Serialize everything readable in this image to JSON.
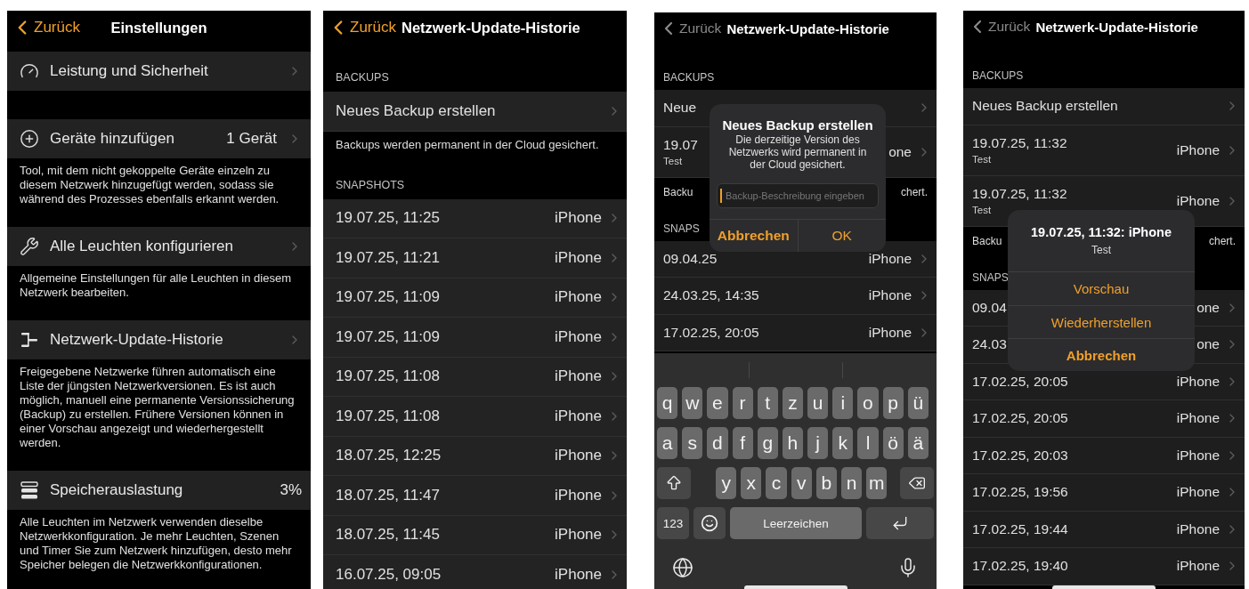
{
  "screens": [
    {
      "kind": "settings",
      "back": "Zurück",
      "title": "Einstellungen",
      "dimmed": false,
      "home_indicator": false,
      "groups": [
        {
          "label": "Leistung und Sicherheit",
          "disclosure": true
        },
        {
          "label": "Geräte hinzufügen",
          "value": "1 Gerät",
          "disclosure": true,
          "footer": "Tool, mit dem nicht gekoppelte Geräte einzeln zu diesem Netzwerk hinzugefügt werden, sodass sie während des Prozesses ebenfalls erkannt werden."
        },
        {
          "label": "Alle Leuchten konfigurieren",
          "disclosure": true,
          "footer": "Allgemeine Einstellungen für alle Leuchten in diesem Netzwerk bearbeiten."
        },
        {
          "label": "Netzwerk-Update-Historie",
          "disclosure": true,
          "footer": "Freigegebene Netzwerke führen automatisch eine Liste der jüngsten Netzwerkversionen. Es ist auch möglich, manuell eine permanente Versionssicherung (Backup) zu erstellen. Frühere Versionen können in einer Vorschau angezeigt und wiederhergestellt werden."
        },
        {
          "label": "Speicherauslastung",
          "value": "3%",
          "disclosure": false,
          "footer": "Alle Leuchten im Netzwerk verwenden dieselbe Netzwerkkonfiguration. Je mehr Leuchten, Szenen und Timer Sie zum Netzwerk hinzufügen, desto mehr Speicher belegen die Netzwerkkonfigurationen."
        }
      ]
    },
    {
      "kind": "history",
      "back": "Zurück",
      "title": "Netzwerk-Update-Historie",
      "dimmed": false,
      "home_indicator": false,
      "sections": [
        {
          "header": "BACKUPS",
          "rows": [
            {
              "label": "Neues Backup erstellen"
            }
          ],
          "footer": [
            "Backups werden permanent in der Cloud gesichert."
          ]
        },
        {
          "header": "SNAPSHOTS",
          "rows": [
            {
              "label": "19.07.25, 11:25",
              "device": "iPhone"
            },
            {
              "label": "19.07.25, 11:21",
              "device": "iPhone"
            },
            {
              "label": "19.07.25, 11:09",
              "device": "iPhone"
            },
            {
              "label": "19.07.25, 11:09",
              "device": "iPhone"
            },
            {
              "label": "19.07.25, 11:08",
              "device": "iPhone"
            },
            {
              "label": "19.07.25, 11:08",
              "device": "iPhone"
            },
            {
              "label": "18.07.25, 12:25",
              "device": "iPhone"
            },
            {
              "label": "18.07.25, 11:47",
              "device": "iPhone"
            },
            {
              "label": "18.07.25, 11:45",
              "device": "iPhone"
            },
            {
              "label": "16.07.25, 09:05",
              "device": "iPhone"
            }
          ]
        }
      ]
    },
    {
      "kind": "history",
      "back": "Zurück",
      "title": "Netzwerk-Update-Historie",
      "dimmed": true,
      "home_indicator": true,
      "sections": [
        {
          "header": "BACKUPS",
          "rows": [
            {
              "label": "Neue"
            },
            {
              "label": "19.07",
              "note": "Test",
              "device": "one"
            }
          ],
          "footer": [
            "Backu",
            "chert."
          ]
        },
        {
          "header": "SNAPS",
          "rows": [
            {
              "label": "09.04.25",
              "device": "iPhone"
            },
            {
              "label": "24.03.25, 14:35",
              "device": "iPhone"
            },
            {
              "label": "17.02.25, 20:05",
              "device": "iPhone"
            }
          ]
        }
      ],
      "alert": {
        "title": "Neues Backup erstellen",
        "message": "Die derzeitige Version des Netzwerks wird permanent in der Cloud gesichert.",
        "placeholder": "Backup-Beschreibung eingeben",
        "buttons": [
          {
            "label": "Abbrechen",
            "preferred": true
          },
          {
            "label": "OK",
            "preferred": false
          }
        ]
      },
      "keyboard": {
        "rows": [
          [
            {
              "kind": "letter",
              "label": "q"
            },
            {
              "kind": "letter",
              "label": "w"
            },
            {
              "kind": "letter",
              "label": "e"
            },
            {
              "kind": "letter",
              "label": "r"
            },
            {
              "kind": "letter",
              "label": "t"
            },
            {
              "kind": "letter",
              "label": "z"
            },
            {
              "kind": "letter",
              "label": "u"
            },
            {
              "kind": "letter",
              "label": "i"
            },
            {
              "kind": "letter",
              "label": "o"
            },
            {
              "kind": "letter",
              "label": "p"
            },
            {
              "kind": "letter",
              "label": "ü"
            }
          ],
          [
            {
              "kind": "letter",
              "label": "a"
            },
            {
              "kind": "letter",
              "label": "s"
            },
            {
              "kind": "letter",
              "label": "d"
            },
            {
              "kind": "letter",
              "label": "f"
            },
            {
              "kind": "letter",
              "label": "g"
            },
            {
              "kind": "letter",
              "label": "h"
            },
            {
              "kind": "letter",
              "label": "j"
            },
            {
              "kind": "letter",
              "label": "k"
            },
            {
              "kind": "letter",
              "label": "l"
            },
            {
              "kind": "letter",
              "label": "ö"
            },
            {
              "kind": "letter",
              "label": "ä"
            }
          ],
          [
            {
              "kind": "shift"
            },
            "",
            {
              "kind": "letter",
              "label": "y"
            },
            {
              "kind": "letter",
              "label": "x"
            },
            {
              "kind": "letter",
              "label": "c"
            },
            {
              "kind": "letter",
              "label": "v"
            },
            {
              "kind": "letter",
              "label": "b"
            },
            {
              "kind": "letter",
              "label": "n"
            },
            {
              "kind": "letter",
              "label": "m"
            },
            {
              "kind": "delete"
            }
          ]
        ],
        "function_keys": [
          {
            "kind": "numbers",
            "label": "123"
          },
          {
            "kind": "emoji"
          },
          {
            "kind": "space",
            "label": "Leerzeichen"
          },
          {
            "kind": "return"
          }
        ],
        "bottom": [
          {
            "kind": "globe"
          },
          {
            "kind": "mic"
          }
        ]
      }
    },
    {
      "kind": "history",
      "back": "Zurück",
      "title": "Netzwerk-Update-Historie",
      "dimmed": true,
      "home_indicator": true,
      "sections": [
        {
          "header": "BACKUPS",
          "rows": [
            {
              "label": "Neues Backup erstellen"
            },
            {
              "label": "19.07.25, 11:32",
              "note": "Test",
              "device": "iPhone"
            },
            {
              "label": "19.07.25, 11:32",
              "note": "Test",
              "device": "iPhone"
            }
          ],
          "footer": [
            "Backu",
            "chert."
          ]
        },
        {
          "header": "SNAPS",
          "rows": [
            {
              "label": "09.04",
              "device": "one"
            },
            {
              "label": "24.03",
              "device": "one"
            },
            {
              "label": "17.02.25, 20:05",
              "device": "iPhone"
            },
            {
              "label": "17.02.25, 20:05",
              "device": "iPhone"
            },
            {
              "label": "17.02.25, 20:03",
              "device": "iPhone"
            },
            {
              "label": "17.02.25, 19:56",
              "device": "iPhone"
            },
            {
              "label": "17.02.25, 19:44",
              "device": "iPhone"
            },
            {
              "label": "17.02.25, 19:40",
              "device": "iPhone"
            }
          ]
        }
      ],
      "action_sheet": {
        "title": "19.07.25, 11:32: iPhone",
        "message": "Test",
        "actions": [
          {
            "label": "Vorschau",
            "preferred": false
          },
          {
            "label": "Wiederherstellen",
            "preferred": false
          },
          {
            "label": "Abbrechen",
            "preferred": true
          }
        ]
      }
    }
  ]
}
